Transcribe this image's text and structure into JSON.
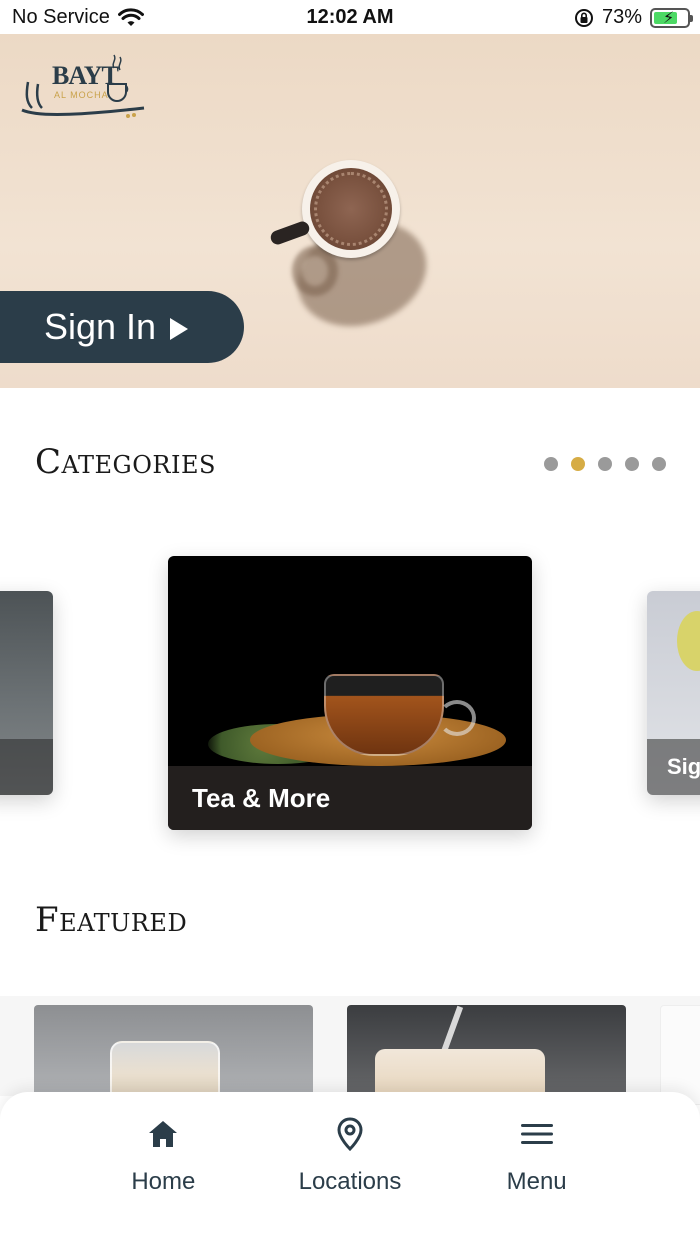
{
  "status_bar": {
    "carrier": "No Service",
    "time": "12:02 AM",
    "battery_percent": "73%",
    "battery_level": 0.73,
    "icons": [
      "wifi-icon",
      "orientation-lock-icon",
      "battery-charging-icon"
    ]
  },
  "hero": {
    "logo_text": "BAYT",
    "logo_subtext": "AL MOCHA",
    "sign_in_label": "Sign In"
  },
  "categories": {
    "title": "Categories",
    "page_count": 5,
    "active_page": 2,
    "cards": [
      {
        "label": ""
      },
      {
        "label": "Tea & More"
      },
      {
        "label": "Sig"
      }
    ]
  },
  "featured": {
    "title": "Featured"
  },
  "nav": {
    "items": [
      {
        "label": "Home",
        "icon": "home-icon"
      },
      {
        "label": "Locations",
        "icon": "location-pin-icon"
      },
      {
        "label": "Menu",
        "icon": "hamburger-menu-icon"
      }
    ]
  },
  "colors": {
    "primary": "#2b3d49",
    "accent": "#d6ac45",
    "dot_inactive": "#9a9a9a",
    "hero_bg": "#ecd9c5"
  }
}
